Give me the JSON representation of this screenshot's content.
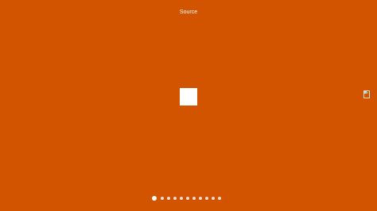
{
  "colors": {
    "background": "#d35400",
    "foreground": "#ffffff"
  },
  "header": {
    "title": "Source"
  },
  "navigation": {
    "next_icon": "broken-image-icon"
  },
  "pagination": {
    "total": 11,
    "active_index": 0
  }
}
